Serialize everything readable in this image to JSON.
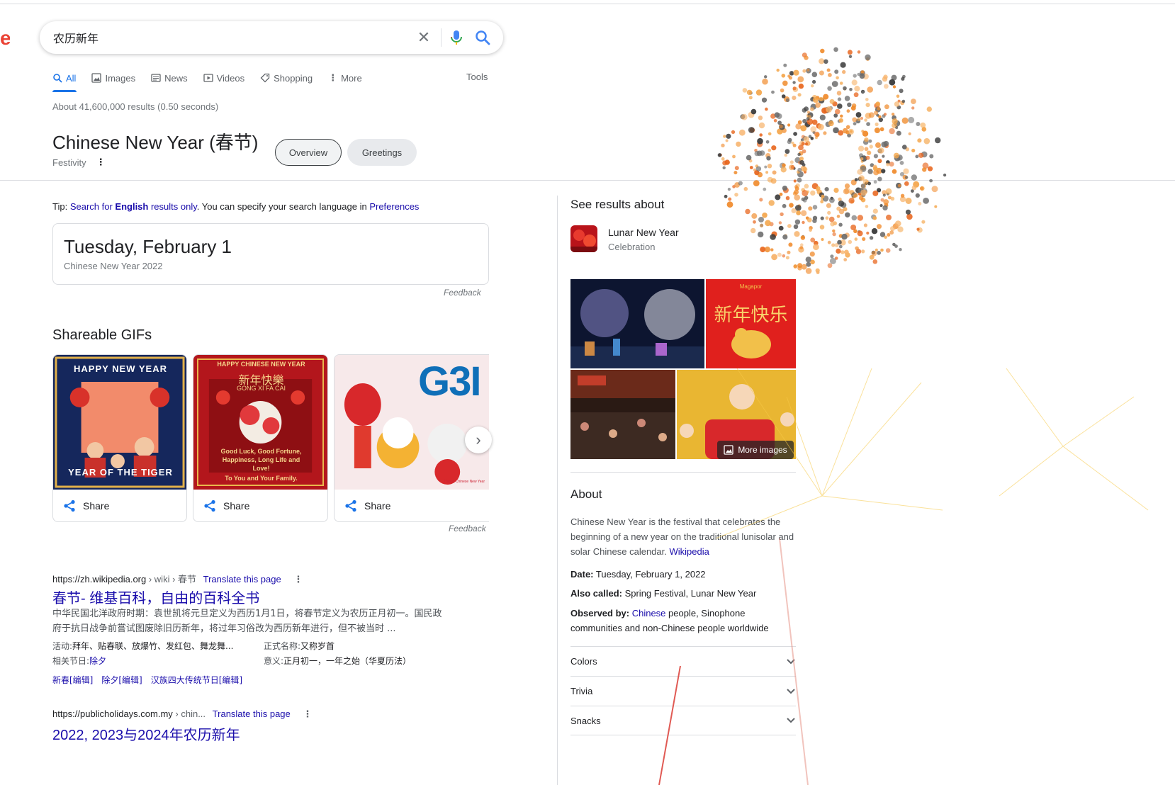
{
  "search": {
    "query": "农历新年"
  },
  "tabs": [
    {
      "label": "All"
    },
    {
      "label": "Images"
    },
    {
      "label": "News"
    },
    {
      "label": "Videos"
    },
    {
      "label": "Shopping"
    },
    {
      "label": "More"
    }
  ],
  "tools_label": "Tools",
  "stats": "About 41,600,000 results (0.50 seconds)",
  "entity": {
    "title": "Chinese New Year (春节)",
    "type": "Festivity",
    "chips": [
      "Overview",
      "Greetings"
    ]
  },
  "tip": {
    "prefix": "Tip: ",
    "link1a": "Search for ",
    "link1b": "English",
    "link1c": " results only",
    "middle": ". You can specify your search language in ",
    "link2": "Preferences"
  },
  "date_card": {
    "main": "Tuesday, February 1",
    "sub": "Chinese New Year 2022",
    "feedback": "Feedback"
  },
  "gifs": {
    "title": "Shareable GIFs",
    "share_label": "Share",
    "feedback": "Feedback",
    "card1": {
      "top": "HAPPY NEW YEAR",
      "bottom": "YEAR OF THE TIGER"
    },
    "card2": {
      "top": "HAPPY CHINESE NEW YEAR",
      "cn": "新年快樂",
      "pinyin": "GONG XI FA CAI",
      "l1": "Good Luck, Good Fortune,",
      "l2": "Happiness, Long Life and",
      "l3": "Love!",
      "l4": "To You and Your Family."
    },
    "card3": {
      "brand": "G3I",
      "foot": "Happy Chinese New Year"
    }
  },
  "results": [
    {
      "site": "https://zh.wikipedia.org",
      "crumbs": " › wiki › 春节",
      "translate": "Translate this page",
      "title": "春节- 维基百科，自由的百科全书",
      "snippet1": "中华民国北洋政府时期：袁世凯将元旦定义为西历1月1日，将春节定义为农历正月初一。国民政",
      "snippet2": "府于抗日战争前嘗试图废除旧历新年，将过年习俗改为西历新年进行，但不被当时 ...",
      "f1_label": "活动:",
      "f1_value": "拜年、贴春联、放爆竹、发红包、舞龙舞...",
      "f2_label": "正式名称:",
      "f2_value": "又称岁首",
      "f3_label": "相关节日:",
      "f3_value": "除夕",
      "f4_label": "意义:",
      "f4_value": "正月初一，一年之始（华夏历法）",
      "sitelinks": [
        "新春[编辑]",
        "除夕[编辑]",
        "汉族四大传统节日[编辑]"
      ]
    },
    {
      "site": "https://publicholidays.com.my",
      "crumbs": " › chin...",
      "translate": "Translate this page",
      "title": "2022, 2023与2024年农历新年"
    }
  ],
  "knowledge": {
    "see_title": "See results about",
    "see_name": "Lunar New Year",
    "see_type": "Celebration",
    "img_text_cn": "新年快乐",
    "img_brand": "Magapor",
    "more_images": "More images",
    "about_title": "About",
    "about_desc": "Chinese New Year is the festival that celebrates the beginning of a new year on the traditional lunisolar and solar Chinese calendar. ",
    "about_link": "Wikipedia",
    "date_label": "Date:",
    "date_value": " Tuesday, February 1, 2022",
    "aka_label": "Also called:",
    "aka_value": " Spring Festival, Lunar New Year",
    "obs_label": "Observed by:",
    "obs_link": "Chinese",
    "obs_value": " people, Sinophone communities and non-Chinese people worldwide",
    "accordions": [
      "Colors",
      "Trivia",
      "Snacks"
    ]
  },
  "colors": {
    "accent": "#1a73e8",
    "link": "#1a0dab",
    "brand_red": "#ea4335"
  }
}
